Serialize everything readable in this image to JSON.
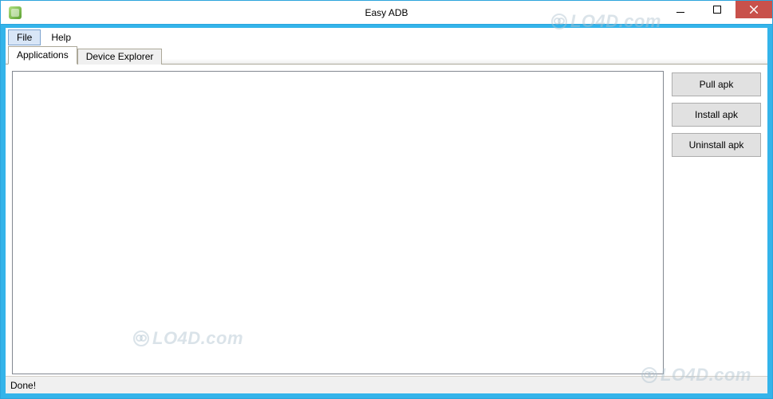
{
  "window": {
    "title": "Easy ADB"
  },
  "menubar": {
    "items": [
      {
        "label": "File",
        "active": true
      },
      {
        "label": "Help",
        "active": false
      }
    ]
  },
  "tabs": [
    {
      "label": "Applications",
      "active": true
    },
    {
      "label": "Device Explorer",
      "active": false
    }
  ],
  "actions": {
    "pull": "Pull apk",
    "install": "Install apk",
    "uninstall": "Uninstall apk"
  },
  "statusbar": {
    "text": "Done!"
  },
  "watermark": {
    "text": "LO4D.com"
  }
}
